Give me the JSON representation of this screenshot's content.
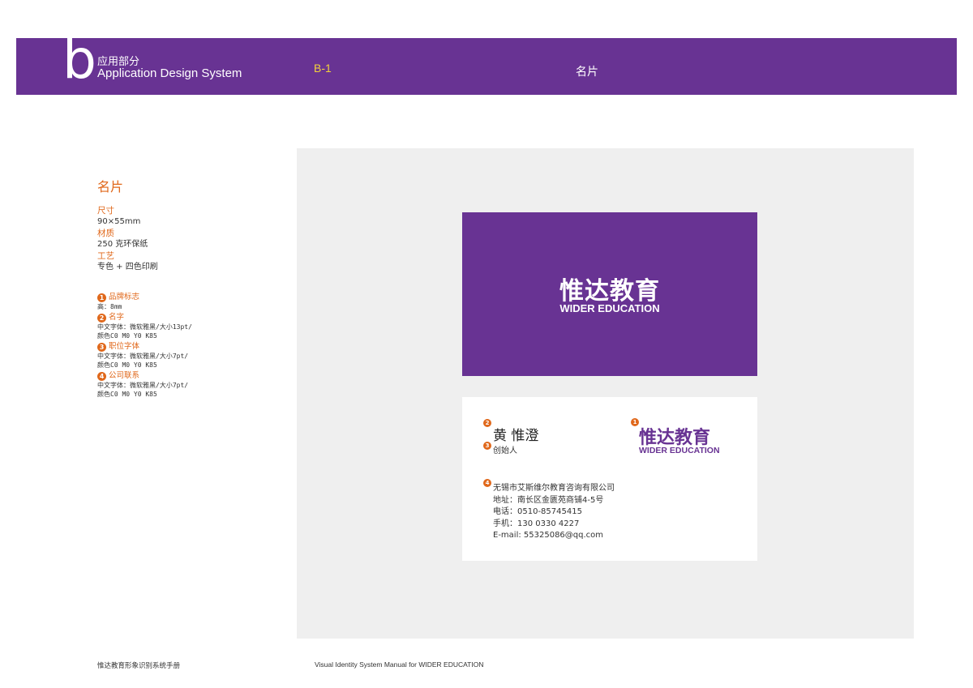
{
  "header": {
    "section_letter": "b",
    "section_cn": "应用部分",
    "section_en": "Application Design System",
    "page_code": "B-1",
    "page_title": "名片"
  },
  "colors": {
    "brand_purple": "#683393",
    "accent_orange": "#e0681b",
    "accent_yellow": "#f3d23a",
    "panel_gray": "#efefef"
  },
  "specs": {
    "title": "名片",
    "items": [
      {
        "label": "尺寸",
        "value": "90×55mm"
      },
      {
        "label": "材质",
        "value": "250 克环保纸"
      },
      {
        "label": "工艺",
        "value": "专色 + 四色印刷"
      }
    ]
  },
  "notes": [
    {
      "num": "1",
      "title": "品牌标志",
      "lines": [
        "高：8mm"
      ]
    },
    {
      "num": "2",
      "title": "名字",
      "lines": [
        "中文字体：微软雅黑/大小13pt/",
        "颜色C0 M0 Y0 K85"
      ]
    },
    {
      "num": "3",
      "title": "职位字体",
      "lines": [
        "中文字体：微软雅黑/大小7pt/",
        "颜色C0 M0 Y0 K85"
      ]
    },
    {
      "num": "4",
      "title": "公司联系",
      "lines": [
        "中文字体：微软雅黑/大小7pt/",
        "颜色C0 M0 Y0 K85"
      ]
    }
  ],
  "card": {
    "logo_cn_main": "惟达教育",
    "logo_en": "WIDER EDUCATION",
    "name": "黄 惟澄",
    "role": "创始人",
    "company": "无锡市艾斯维尔教育咨询有限公司",
    "address": "地址：南长区金匮苑商铺4-5号",
    "phone": "电话：0510-85745415",
    "mobile": "手机：130 0330 4227",
    "email": "E-mail: 55325086@qq.com",
    "badges": [
      "1",
      "2",
      "3",
      "4"
    ]
  },
  "footer": {
    "cn": "惟达教育形象识别系统手册",
    "en": "Visual Identity System Manual for WIDER EDUCATION"
  }
}
